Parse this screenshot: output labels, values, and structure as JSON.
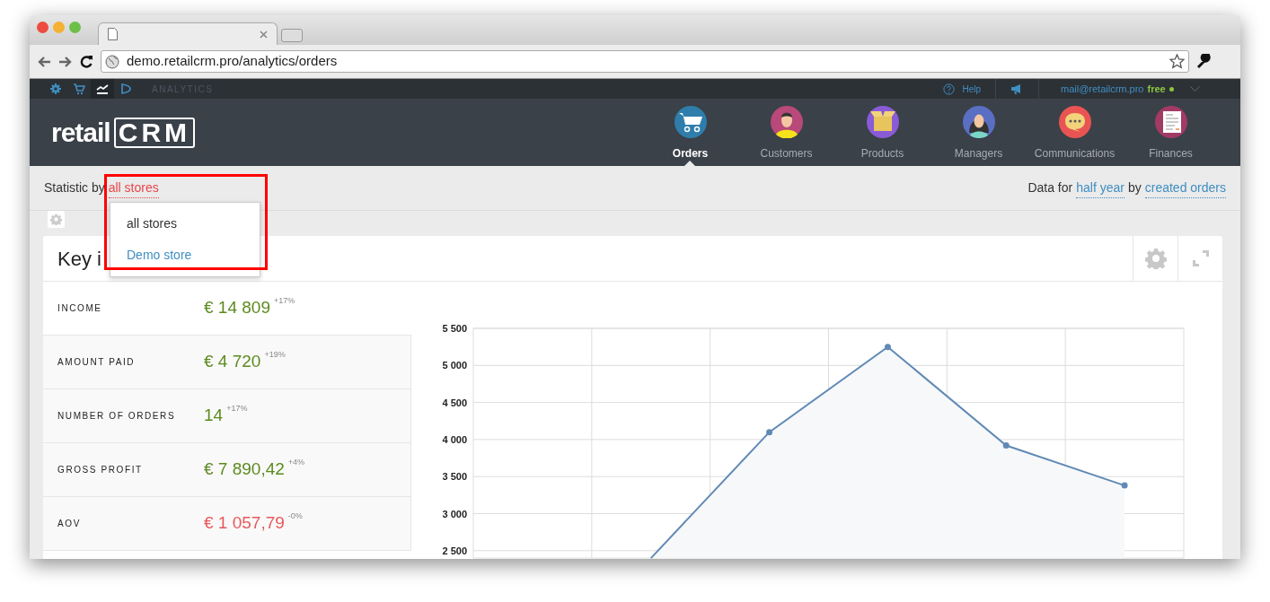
{
  "browser": {
    "url": "demo.retailcrm.pro/analytics/orders"
  },
  "top_bar": {
    "section": "ANALYTICS",
    "icons": [
      {
        "kind": "gear",
        "selected": false
      },
      {
        "kind": "cart",
        "selected": false
      },
      {
        "kind": "chart",
        "selected": true
      },
      {
        "kind": "play",
        "selected": false
      }
    ],
    "help": "Help",
    "email": "mail@retailcrm.pro",
    "plan": "free"
  },
  "logo": {
    "text": "retail",
    "boxed": "CRM"
  },
  "nav": [
    {
      "kind": "cart",
      "label": "Orders",
      "selected": true
    },
    {
      "kind": "customer",
      "label": "Customers",
      "selected": false
    },
    {
      "kind": "product",
      "label": "Products",
      "selected": false
    },
    {
      "kind": "manager",
      "label": "Managers",
      "selected": false
    },
    {
      "kind": "chat",
      "label": "Communications",
      "selected": false
    },
    {
      "kind": "finance",
      "label": "Finances",
      "selected": false
    }
  ],
  "filter": {
    "prefix": "Statistic by",
    "store": "all stores",
    "data_for": "Data for",
    "period": "half year",
    "by": "by",
    "basis": "created orders"
  },
  "store_menu": [
    {
      "label": "all stores",
      "selected": true
    },
    {
      "label": "Demo store",
      "selected": false
    }
  ],
  "card": {
    "title": "Key i",
    "indicators": [
      {
        "label": "INCOME",
        "value": "€ 14 809",
        "change": "+17%",
        "color": "#5c8a1e"
      },
      {
        "label": "AMOUNT PAID",
        "value": "€ 4 720",
        "change": "+19%",
        "color": "#5c8a1e"
      },
      {
        "label": "NUMBER OF ORDERS",
        "value": "14",
        "change": "+17%",
        "color": "#5c8a1e"
      },
      {
        "label": "GROSS PROFIT",
        "value": "€ 7 890,42",
        "change": "+4%",
        "color": "#5c8a1e"
      },
      {
        "label": "AOV",
        "value": "€ 1 057,79",
        "change": "-0%",
        "color": "#e8585b"
      }
    ],
    "chart_data": {
      "type": "area",
      "categories": [
        null,
        null,
        null,
        null,
        null
      ],
      "grid": true,
      "ylim": [
        2400,
        5500
      ],
      "yticks": [
        {
          "value": 2500,
          "label": "2 500"
        },
        {
          "value": 3000,
          "label": "3 000"
        },
        {
          "value": 3500,
          "label": "3 500"
        },
        {
          "value": 4000,
          "label": "4 000"
        },
        {
          "value": 4500,
          "label": "4 500"
        },
        {
          "value": 5000,
          "label": "5 000"
        },
        {
          "value": 5500,
          "label": "5 500"
        }
      ],
      "series": [
        {
          "color": "#6189b5",
          "values": [
            2400,
            4100,
            5250,
            3920,
            3380
          ]
        }
      ]
    }
  }
}
